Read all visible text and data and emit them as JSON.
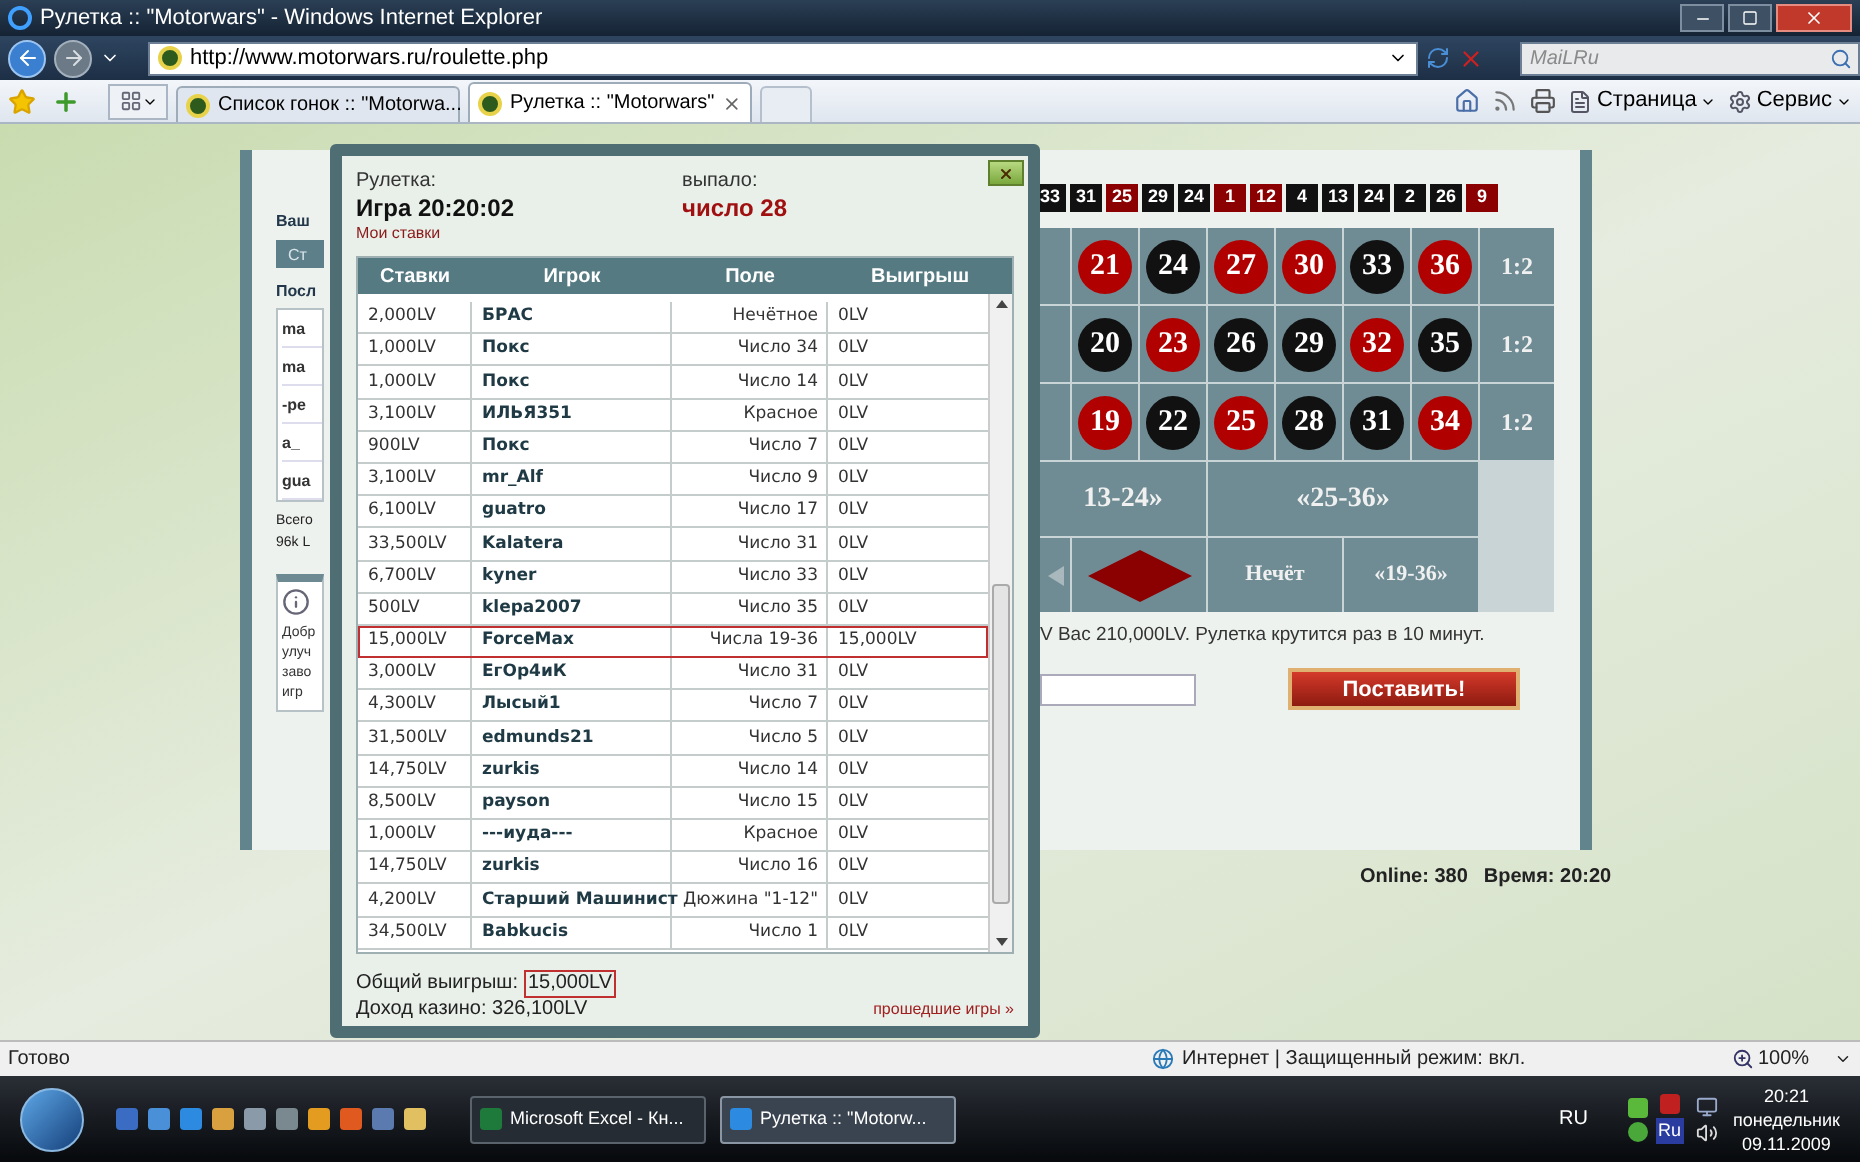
{
  "window": {
    "title": "Рулетка :: \"Motorwars\" - Windows Internet Explorer"
  },
  "address_bar": {
    "url": "http://www.motorwars.ru/roulette.php"
  },
  "search": {
    "placeholder": "MaiLRu"
  },
  "tabs": [
    {
      "title": "Список гонок :: \"Motorwa...",
      "selected": false
    },
    {
      "title": "Рулетка :: \"Motorwars\"",
      "selected": true
    }
  ],
  "toolbar": {
    "page_menu": "Страница",
    "tools_menu": "Сервис"
  },
  "left_panel": {
    "heading": "Ваш",
    "tab": "Ст",
    "recent_heading": "Посл",
    "items": [
      "ma",
      "ma",
      "-pe",
      "a_",
      "gua"
    ],
    "total": [
      "Всего",
      "96k L"
    ],
    "info_lines": [
      "Добр",
      "улуч",
      "заво",
      "игр"
    ]
  },
  "history": [
    {
      "n": "33",
      "color": "#111111"
    },
    {
      "n": "31",
      "color": "#111111"
    },
    {
      "n": "25",
      "color": "#8b0000"
    },
    {
      "n": "29",
      "color": "#111111"
    },
    {
      "n": "24",
      "color": "#111111"
    },
    {
      "n": "1",
      "color": "#8b0000"
    },
    {
      "n": "12",
      "color": "#8b0000"
    },
    {
      "n": "4",
      "color": "#111111"
    },
    {
      "n": "13",
      "color": "#111111"
    },
    {
      "n": "24",
      "color": "#111111"
    },
    {
      "n": "2",
      "color": "#111111"
    },
    {
      "n": "26",
      "color": "#111111"
    },
    {
      "n": "9",
      "color": "#8b0000"
    }
  ],
  "board": {
    "rows": [
      {
        "cells": [
          {
            "n": "21",
            "color": "#b00000"
          },
          {
            "n": "24",
            "color": "#111111"
          },
          {
            "n": "27",
            "color": "#b00000"
          },
          {
            "n": "30",
            "color": "#b00000"
          },
          {
            "n": "33",
            "color": "#111111"
          },
          {
            "n": "36",
            "color": "#b00000"
          }
        ],
        "column_bet": "1:2"
      },
      {
        "cells": [
          {
            "n": "20",
            "color": "#111111"
          },
          {
            "n": "23",
            "color": "#b00000"
          },
          {
            "n": "26",
            "color": "#111111"
          },
          {
            "n": "29",
            "color": "#111111"
          },
          {
            "n": "32",
            "color": "#b00000"
          },
          {
            "n": "35",
            "color": "#111111"
          }
        ],
        "column_bet": "1:2"
      },
      {
        "cells": [
          {
            "n": "19",
            "color": "#b00000"
          },
          {
            "n": "22",
            "color": "#111111"
          },
          {
            "n": "25",
            "color": "#b00000"
          },
          {
            "n": "28",
            "color": "#111111"
          },
          {
            "n": "31",
            "color": "#111111"
          },
          {
            "n": "34",
            "color": "#b00000"
          }
        ],
        "column_bet": "1:2"
      }
    ],
    "dozens": [
      "13-24»",
      "«25-36»"
    ],
    "bottom": [
      {
        "kind": "arrow"
      },
      {
        "kind": "diamond"
      },
      {
        "kind": "text",
        "label": "Нечёт"
      },
      {
        "kind": "text",
        "label": "«19-36»"
      }
    ]
  },
  "info_text": "V Вас 210,000LV. Рулетка крутится раз в 10 минут.",
  "bet_button": "Поставить!",
  "online": "Online: 380",
  "time": "Время: 20:20",
  "modal": {
    "label": "Рулетка:",
    "game": "Игра 20:20:02",
    "my_bets": "Мои ставки",
    "result_label": "выпало:",
    "result": "число 28",
    "columns": [
      "Ставки",
      "Игрок",
      "Поле",
      "Выигрыш"
    ],
    "rows": [
      {
        "bet": "2,000LV",
        "player": "БРАС",
        "field": "Нечётное",
        "win": "0LV",
        "highlighted": false
      },
      {
        "bet": "1,000LV",
        "player": "Покс",
        "field": "Число 34",
        "win": "0LV",
        "highlighted": false
      },
      {
        "bet": "1,000LV",
        "player": "Покс",
        "field": "Число 14",
        "win": "0LV",
        "highlighted": false
      },
      {
        "bet": "3,100LV",
        "player": "ИЛЬЯ351",
        "field": "Красное",
        "win": "0LV",
        "highlighted": false
      },
      {
        "bet": "900LV",
        "player": "Покс",
        "field": "Число 7",
        "win": "0LV",
        "highlighted": false
      },
      {
        "bet": "3,100LV",
        "player": "mr_Alf",
        "field": "Число 9",
        "win": "0LV",
        "highlighted": false
      },
      {
        "bet": "6,100LV",
        "player": "guatro",
        "field": "Число 17",
        "win": "0LV",
        "highlighted": false
      },
      {
        "bet": "33,500LV",
        "player": "Kalatera",
        "field": "Число 31",
        "win": "0LV",
        "highlighted": false
      },
      {
        "bet": "6,700LV",
        "player": "kyner",
        "field": "Число 33",
        "win": "0LV",
        "highlighted": false
      },
      {
        "bet": "500LV",
        "player": "klepa2007",
        "field": "Число 35",
        "win": "0LV",
        "highlighted": false
      },
      {
        "bet": "15,000LV",
        "player": "ForceMax",
        "field": "Числа 19-36",
        "win": "15,000LV",
        "highlighted": true
      },
      {
        "bet": "3,000LV",
        "player": "ЕгОр4иК",
        "field": "Число 31",
        "win": "0LV",
        "highlighted": false
      },
      {
        "bet": "4,300LV",
        "player": "Лысый1",
        "field": "Число 7",
        "win": "0LV",
        "highlighted": false
      },
      {
        "bet": "31,500LV",
        "player": "edmunds21",
        "field": "Число 5",
        "win": "0LV",
        "highlighted": false
      },
      {
        "bet": "14,750LV",
        "player": "zurkis",
        "field": "Число 14",
        "win": "0LV",
        "highlighted": false
      },
      {
        "bet": "8,500LV",
        "player": "payson",
        "field": "Число 15",
        "win": "0LV",
        "highlighted": false
      },
      {
        "bet": "1,000LV",
        "player": "---иуда---",
        "field": "Красное",
        "win": "0LV",
        "highlighted": false
      },
      {
        "bet": "14,750LV",
        "player": "zurkis",
        "field": "Число 16",
        "win": "0LV",
        "highlighted": false
      },
      {
        "bet": "4,200LV",
        "player": "Старший Машинист",
        "field": "Дюжина \"1-12\"",
        "win": "0LV",
        "highlighted": false
      },
      {
        "bet": "34,500LV",
        "player": "Babkucis",
        "field": "Число 1",
        "win": "0LV",
        "highlighted": false
      }
    ],
    "total_label": "Общий выигрыш:",
    "total": "15,000LV",
    "total_highlighted": true,
    "casino": "Доход казино: 326,100LV",
    "past_games": "прошедшие игры »"
  },
  "status_bar": {
    "status": "Готово",
    "zone": "Интернет | Защищенный режим: вкл.",
    "zoom": "100%"
  },
  "taskbar": {
    "tasks": [
      {
        "label": "Microsoft Excel - Кн...",
        "selected": false
      },
      {
        "label": "Рулетка :: \"Motorw...",
        "selected": true
      }
    ],
    "language": "RU",
    "tray_lang": "Ru",
    "clock": "20:21",
    "day": "понедельник",
    "date": "09.11.2009"
  }
}
